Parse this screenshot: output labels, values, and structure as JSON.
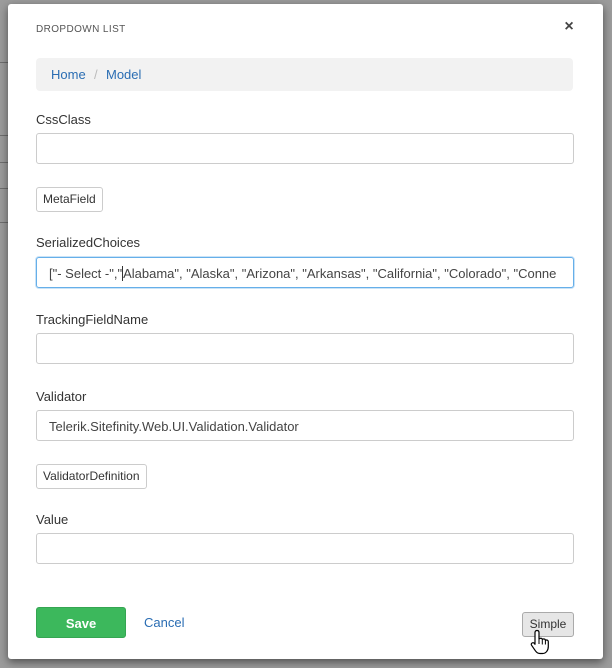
{
  "dialog": {
    "title": "DROPDOWN LIST",
    "close_glyph": "×"
  },
  "breadcrumb": {
    "home": "Home",
    "separator": "/",
    "current": "Model"
  },
  "fields": {
    "css_class": {
      "label": "CssClass",
      "value": ""
    },
    "meta_field_button": "MetaField",
    "serialized_choices": {
      "label": "SerializedChoices",
      "value_before_caret": "[\"- Select -\",\"",
      "value_after_caret": "Alabama\", \"Alaska\", \"Arizona\", \"Arkansas\", \"California\", \"Colorado\", \"Conne"
    },
    "tracking_field_name": {
      "label": "TrackingFieldName",
      "value": ""
    },
    "validator": {
      "label": "Validator",
      "value": "Telerik.Sitefinity.Web.UI.Validation.Validator"
    },
    "validator_definition_button": "ValidatorDefinition",
    "value": {
      "label": "Value",
      "value": ""
    }
  },
  "footer": {
    "save_label": "Save",
    "cancel_label": "Cancel",
    "simple_label": "Simple"
  },
  "colors": {
    "save": "#3cb85c",
    "link": "#2a6db3",
    "focus_border": "#66afe9"
  },
  "icons": {
    "close": "close-icon",
    "cursor": "hand-pointer-icon"
  }
}
